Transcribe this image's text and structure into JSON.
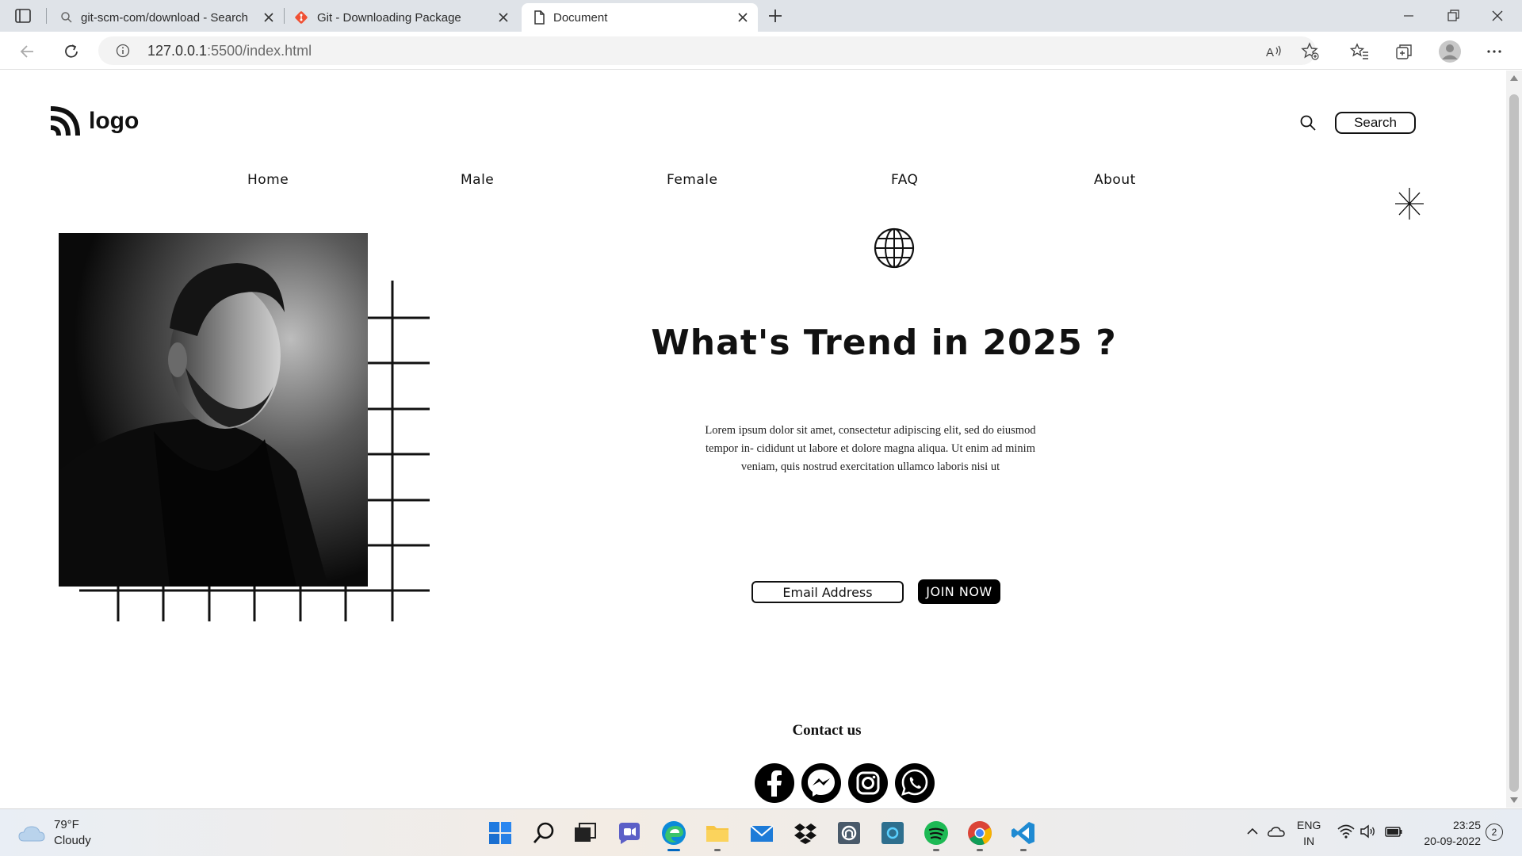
{
  "browser": {
    "tabs": [
      {
        "title": "git-scm-com/download - Search",
        "icon": "search-icon",
        "active": false
      },
      {
        "title": "Git - Downloading Package",
        "icon": "git-icon",
        "active": false
      },
      {
        "title": "Document",
        "icon": "document-icon",
        "active": true
      }
    ],
    "url_host": "127.0.0.1",
    "url_rest": ":5500/index.html"
  },
  "page": {
    "logo_text": "logo",
    "search_button": "Search",
    "nav": [
      "Home",
      "Male",
      "Female",
      "FAQ",
      "About"
    ],
    "headline": "What's Trend in 2025 ?",
    "lorem": "Lorem ipsum dolor sit amet, consectetur adipiscing elit, sed do eiusmod tempor in- cididunt ut labore et dolore magna aliqua. Ut enim ad minim veniam, quis nostrud exercitation ullamco laboris nisi ut",
    "email_placeholder": "Email Address",
    "join_button": "JOIN NOW",
    "contact_title": "Contact us",
    "social": [
      "facebook-icon",
      "messenger-icon",
      "instagram-icon",
      "whatsapp-icon"
    ]
  },
  "taskbar": {
    "temperature": "79°F",
    "weather": "Cloudy",
    "lang_line1": "ENG",
    "lang_line2": "IN",
    "time": "23:25",
    "date": "20-09-2022",
    "notifications": "2"
  }
}
